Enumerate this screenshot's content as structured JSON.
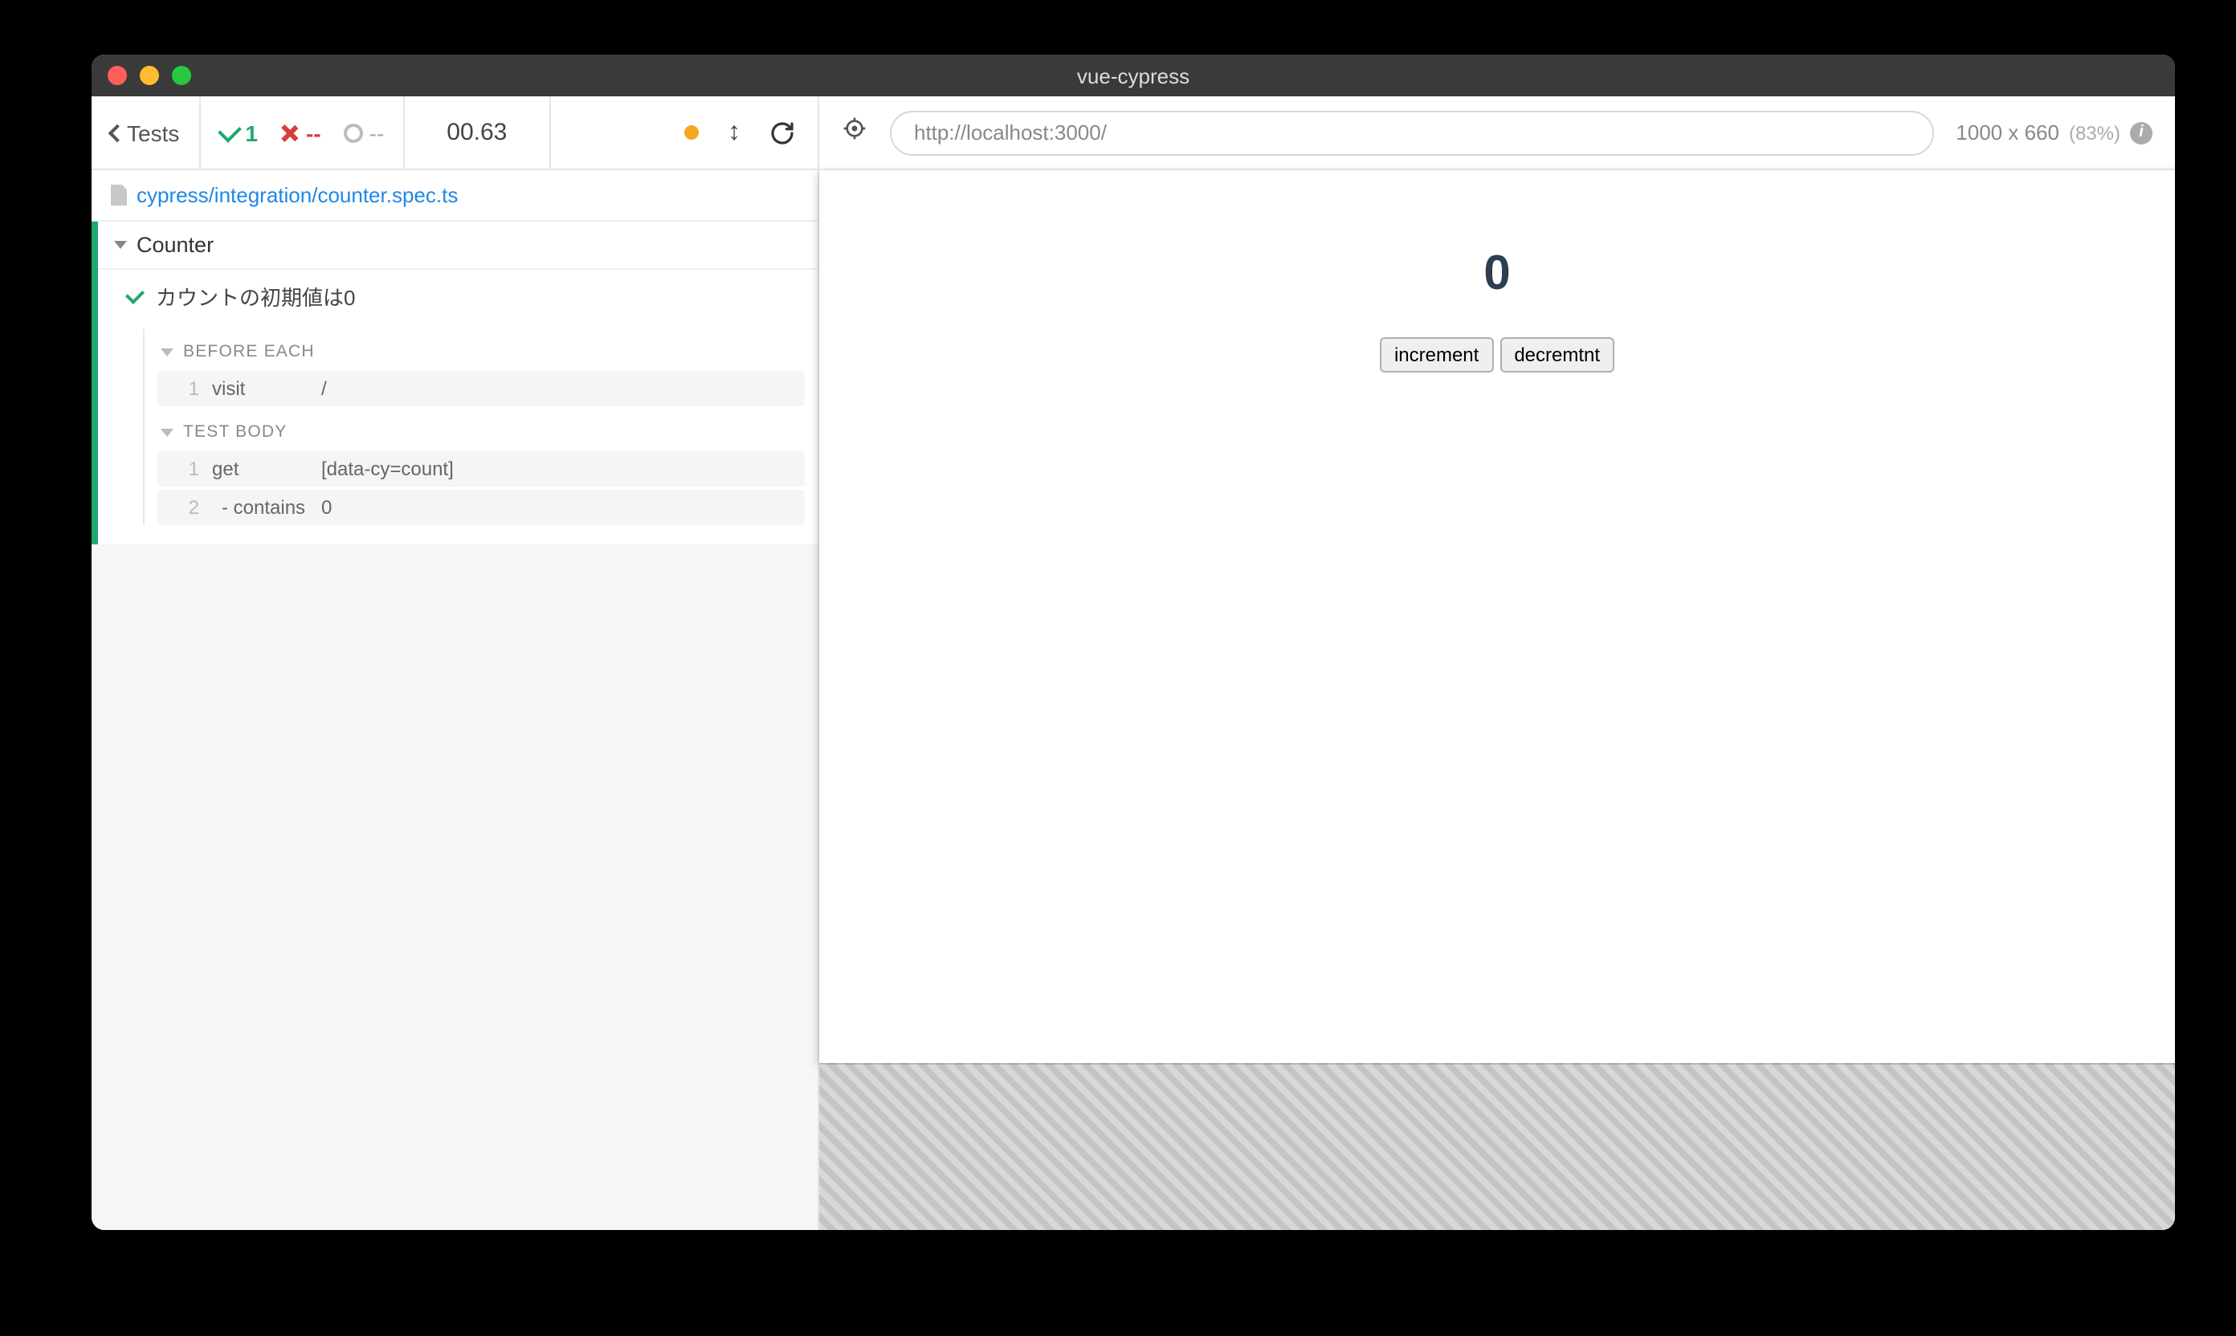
{
  "titlebar": {
    "title": "vue-cypress"
  },
  "toolbar": {
    "back_label": "Tests",
    "pass_count": "1",
    "fail_count": "--",
    "pending_count": "--",
    "duration": "00.63"
  },
  "spec": {
    "path": "cypress/integration/counter.spec.ts"
  },
  "suite": {
    "name": "Counter",
    "tests": [
      {
        "title": "カウントの初期値は0"
      }
    ]
  },
  "commands": {
    "before_each": {
      "header": "BEFORE EACH",
      "items": [
        {
          "num": "1",
          "name": "visit",
          "arg": "/"
        }
      ]
    },
    "test_body": {
      "header": "TEST BODY",
      "items": [
        {
          "num": "1",
          "name": "get",
          "arg": "[data-cy=count]"
        },
        {
          "num": "2",
          "name": "- contains",
          "arg": "0"
        }
      ]
    }
  },
  "preview": {
    "url": "http://localhost:3000/",
    "viewport": "1000 x 660",
    "scale": "(83%)",
    "counter_value": "0",
    "buttons": {
      "inc": "increment",
      "dec": "decremtnt"
    }
  }
}
